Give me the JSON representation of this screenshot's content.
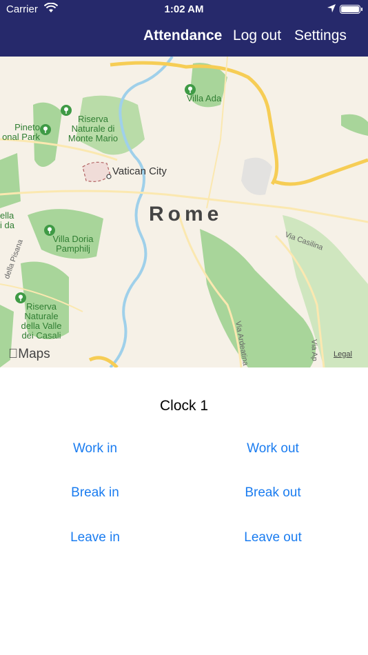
{
  "status_bar": {
    "carrier": "Carrier",
    "time": "1:02 AM"
  },
  "nav": {
    "attendance": "Attendance",
    "logout": "Log out",
    "settings": "Settings"
  },
  "map": {
    "city": "Rome",
    "vatican": "Vatican City",
    "parks": [
      {
        "label": "Villa Ada"
      },
      {
        "label": "Riserva Naturale di Monte Mario"
      },
      {
        "label": "Pineto onal Park"
      },
      {
        "label": "Villa Doria Pamphilj"
      },
      {
        "label": "Riserva Naturale della Valle dei Casali"
      },
      {
        "label": "ella i da"
      }
    ],
    "streets": [
      {
        "label": "Via Casilina"
      },
      {
        "label": "Via Ardeatina"
      },
      {
        "label": "Via Ap"
      },
      {
        "label": "della Pisana"
      }
    ],
    "attribution": "Maps",
    "legal": "Legal"
  },
  "clock": {
    "title": "Clock 1"
  },
  "actions": {
    "work_in": "Work in",
    "work_out": "Work out",
    "break_in": "Break in",
    "break_out": "Break out",
    "leave_in": "Leave in",
    "leave_out": "Leave out"
  },
  "colors": {
    "nav_bg": "#26296b",
    "button": "#1a7cf0",
    "map_bg": "#f6f1e7",
    "park": "#a8d59a"
  }
}
